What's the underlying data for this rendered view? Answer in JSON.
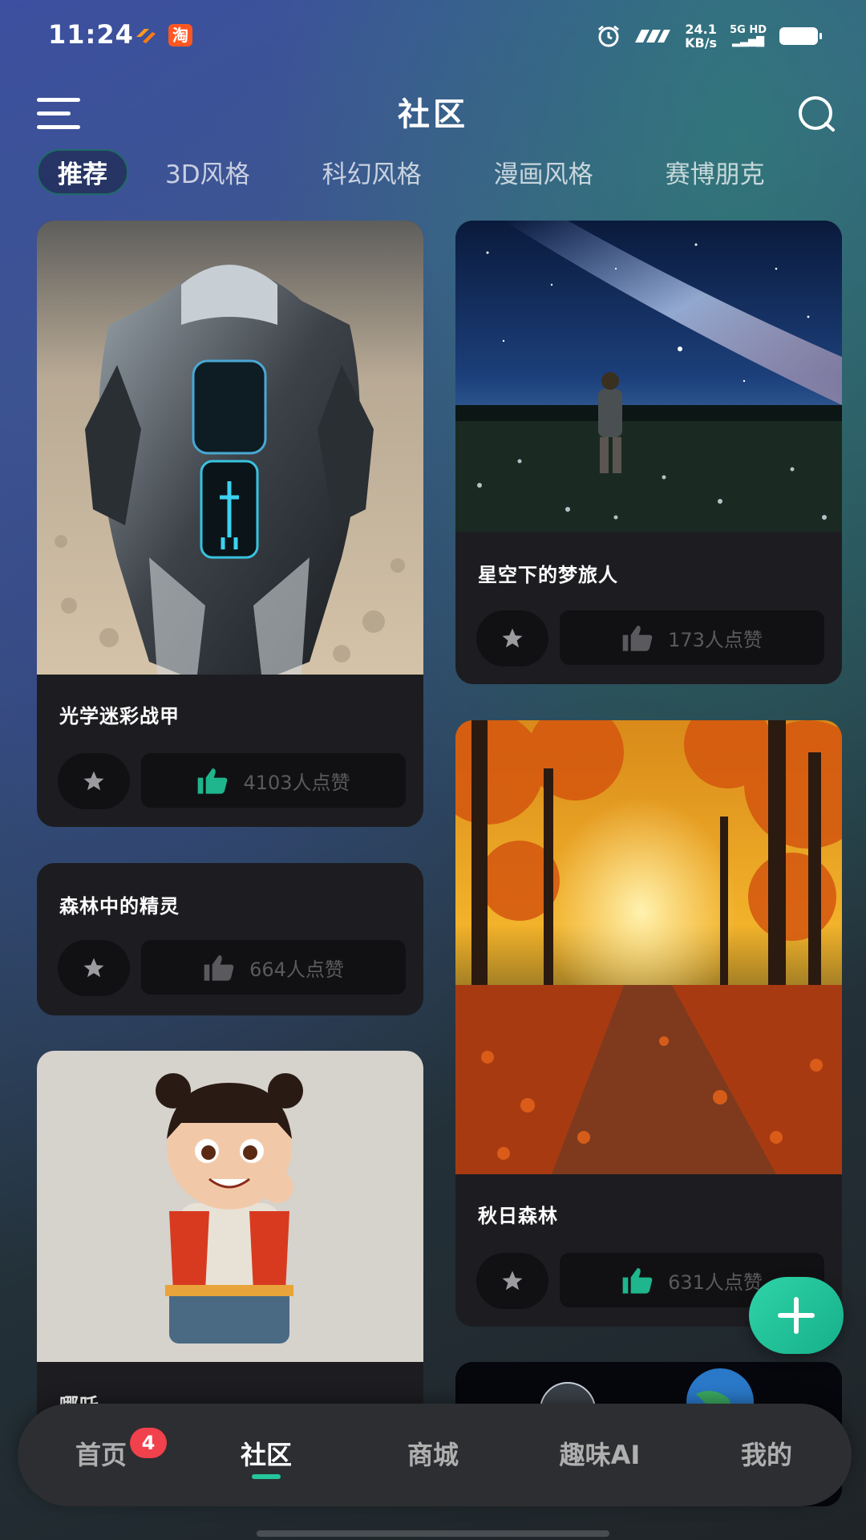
{
  "status_bar": {
    "time": "11:24",
    "app_badge": "淘",
    "net_speed_value": "24.1",
    "net_speed_unit": "KB/s",
    "signal": "5G HD",
    "icons": [
      "alarm-icon",
      "nfc-icon",
      "signal-icon",
      "battery-icon"
    ]
  },
  "header": {
    "title": "社区",
    "menu_icon": "menu-icon",
    "search_icon": "search-icon"
  },
  "tabs": [
    {
      "label": "推荐",
      "active": true
    },
    {
      "label": "3D风格",
      "active": false
    },
    {
      "label": "科幻风格",
      "active": false
    },
    {
      "label": "漫画风格",
      "active": false
    },
    {
      "label": "赛博朋克",
      "active": false
    }
  ],
  "cards": [
    {
      "title": "光学迷彩战甲",
      "likes": "4103人点赞",
      "liked": true
    },
    {
      "title": "星空下的梦旅人",
      "likes": "173人点赞",
      "liked": false
    },
    {
      "title": "森林中的精灵",
      "likes": "664人点赞",
      "liked": false
    },
    {
      "title": "秋日森林",
      "likes": "631人点赞",
      "liked": true
    },
    {
      "title": "哪吒",
      "likes": "",
      "liked": false
    }
  ],
  "bottom_nav": {
    "items": [
      {
        "label": "首页",
        "badge": "4"
      },
      {
        "label": "社区",
        "active": true
      },
      {
        "label": "商城"
      },
      {
        "label": "趣味AI"
      },
      {
        "label": "我的"
      }
    ]
  },
  "colors": {
    "accent": "#24c79b",
    "like_active": "#1fb58d",
    "like_inactive": "#5a5a5e",
    "card_bg": "#1d1d21",
    "badge": "#f0414c"
  }
}
